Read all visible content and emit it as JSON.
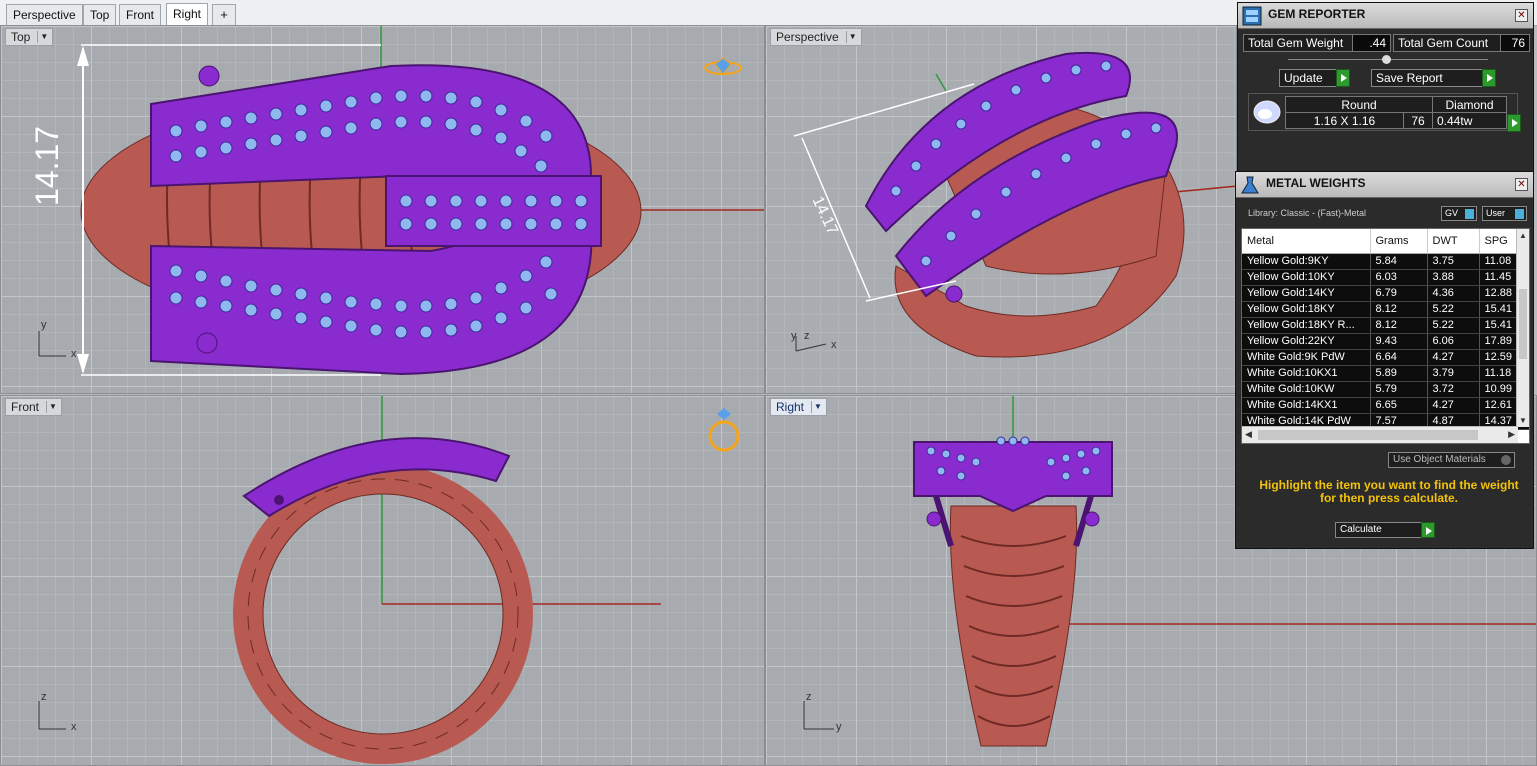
{
  "tabs": [
    {
      "label": "Perspective"
    },
    {
      "label": "Top"
    },
    {
      "label": "Front"
    },
    {
      "label": "Right",
      "active": true
    },
    {
      "label": "+",
      "icon": "plus-icon"
    }
  ],
  "viewports": {
    "top": {
      "label": "Top",
      "dimension": "14.17",
      "axes": {
        "a": "y",
        "b": "x"
      }
    },
    "perspective": {
      "label": "Perspective",
      "dimension": "14.17",
      "axes": {
        "a": "y",
        "b": "z",
        "c": "x"
      }
    },
    "front": {
      "label": "Front",
      "axes": {
        "a": "z",
        "b": "x"
      }
    },
    "right": {
      "label": "Right",
      "axes": {
        "a": "z",
        "b": "y"
      }
    }
  },
  "gem_reporter": {
    "title": "GEM REPORTER",
    "total_weight_label": "Total Gem Weight",
    "total_weight_value": ".44",
    "total_count_label": "Total Gem Count",
    "total_count_value": "76",
    "update_label": "Update",
    "save_report_label": "Save Report",
    "gems": [
      {
        "shape": "Round",
        "type": "Diamond",
        "size": "1.16 X 1.16",
        "count": "76",
        "weight": "0.44tw"
      }
    ]
  },
  "metal_weights": {
    "title": "METAL WEIGHTS",
    "library": "Library: Classic - (Fast)-Metal",
    "gv_label": "GV",
    "user_label": "User",
    "columns": [
      "Metal",
      "Grams",
      "DWT",
      "SPG"
    ],
    "rows": [
      [
        "Yellow Gold:9KY",
        "5.84",
        "3.75",
        "11.08"
      ],
      [
        "Yellow Gold:10KY",
        "6.03",
        "3.88",
        "11.45"
      ],
      [
        "Yellow Gold:14KY",
        "6.79",
        "4.36",
        "12.88"
      ],
      [
        "Yellow Gold:18KY",
        "8.12",
        "5.22",
        "15.41"
      ],
      [
        "Yellow Gold:18KY R...",
        "8.12",
        "5.22",
        "15.41"
      ],
      [
        "Yellow Gold:22KY",
        "9.43",
        "6.06",
        "17.89"
      ],
      [
        "White Gold:9K PdW",
        "6.64",
        "4.27",
        "12.59"
      ],
      [
        "White Gold:10KX1",
        "5.89",
        "3.79",
        "11.18"
      ],
      [
        "White Gold:10KW",
        "5.79",
        "3.72",
        "10.99"
      ],
      [
        "White Gold:14KX1",
        "6.65",
        "4.27",
        "12.61"
      ],
      [
        "White Gold:14K PdW",
        "7.57",
        "4.87",
        "14.37"
      ]
    ],
    "use_object_materials_label": "Use Object Materials",
    "hint": "Highlight the item you want to find the weight for then press calculate.",
    "calculate_label": "Calculate"
  },
  "colors": {
    "gold_band": "#b85a52",
    "purple_head": "#8a2bd0",
    "gems": "#8fb8f0",
    "panel_bg": "#2b2b2b",
    "accent_green": "#2c9a2c",
    "hint_yellow": "#f3c20d"
  }
}
